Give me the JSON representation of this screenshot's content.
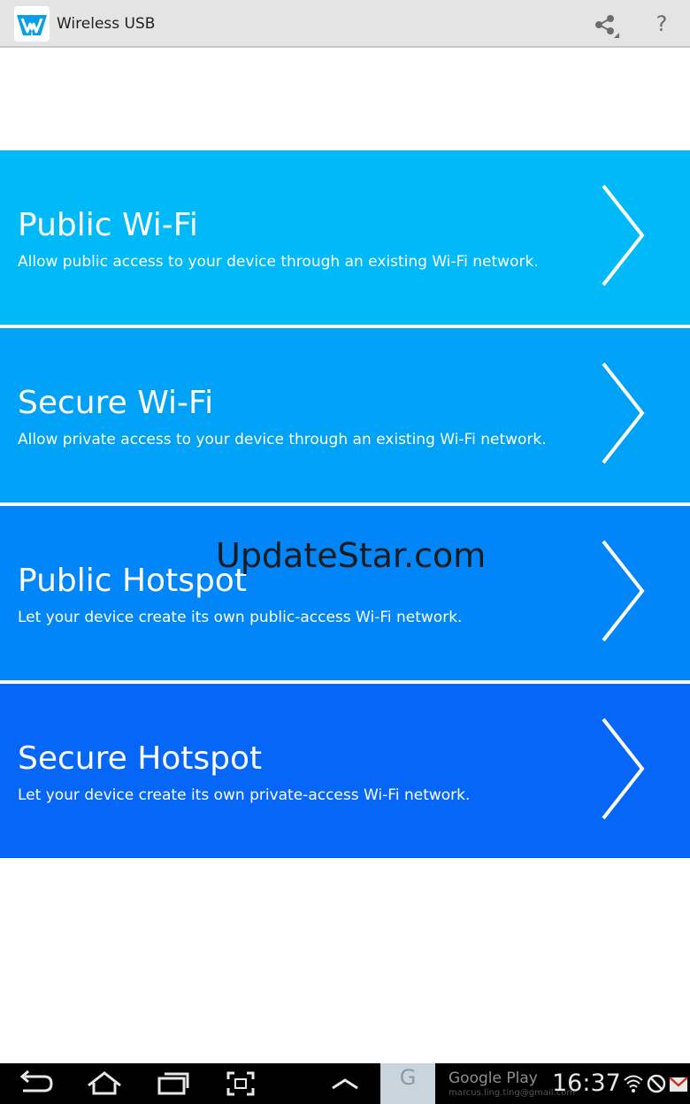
{
  "app": {
    "title": "Wireless USB"
  },
  "options": [
    {
      "title": "Public Wi-Fi",
      "description": "Allow public access to your device through an existing Wi-Fi network."
    },
    {
      "title": "Secure Wi-Fi",
      "description": "Allow private access to your device through an existing Wi-Fi network."
    },
    {
      "title": "Public Hotspot",
      "description": "Let your device create its own public-access Wi-Fi network."
    },
    {
      "title": "Secure Hotspot",
      "description": "Let your device create its own private-access Wi-Fi network."
    }
  ],
  "watermark": "UpdateStar.com",
  "help_glyph": "?",
  "status_bar": {
    "notification_letter": "G",
    "notification_title": "Google Play",
    "notification_subtitle": "marcus.ling.ting@gmail.com",
    "time": "16:37"
  },
  "colors": {
    "option_1": "#00b9f9",
    "option_2": "#00a2f7",
    "option_3": "#0086f8",
    "option_4": "#0566f8"
  }
}
